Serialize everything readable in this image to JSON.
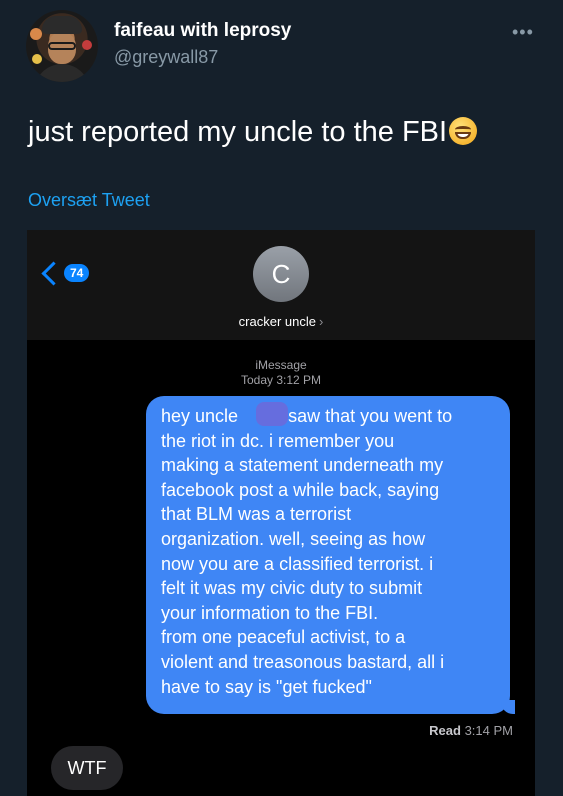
{
  "tweet": {
    "display_name": "faifeau with leprosy",
    "handle": "@greywall87",
    "more_icon": "•••",
    "text": "just reported my uncle to the FBI",
    "emoji": "grinning-face-emoji",
    "translate_link": "Oversæt Tweet"
  },
  "imessage": {
    "back_count": "74",
    "contact_initial": "C",
    "contact_name": "cracker uncle",
    "contact_chevron": "›",
    "service": "iMessage",
    "timestamp": "Today 3:12 PM",
    "sent_message_lines": [
      "hey uncle          saw that you went to",
      "the riot in dc. i remember you",
      "making a statement underneath my",
      "facebook post a while back, saying",
      "that BLM was a terrorist",
      "organization. well, seeing as how",
      "now you are a classified terrorist. i",
      "felt it was my civic duty to submit",
      "your information to the FBI.",
      "from one peaceful activist, to a",
      "violent and treasonous bastard, all i",
      "have to say is \"get fucked\""
    ],
    "read_label": "Read",
    "read_time": "3:14 PM",
    "reply": "WTF"
  },
  "colors": {
    "background": "#15202b",
    "link": "#1da1f2",
    "bubble": "#3f86f5",
    "ios_blue": "#0a84ff"
  }
}
